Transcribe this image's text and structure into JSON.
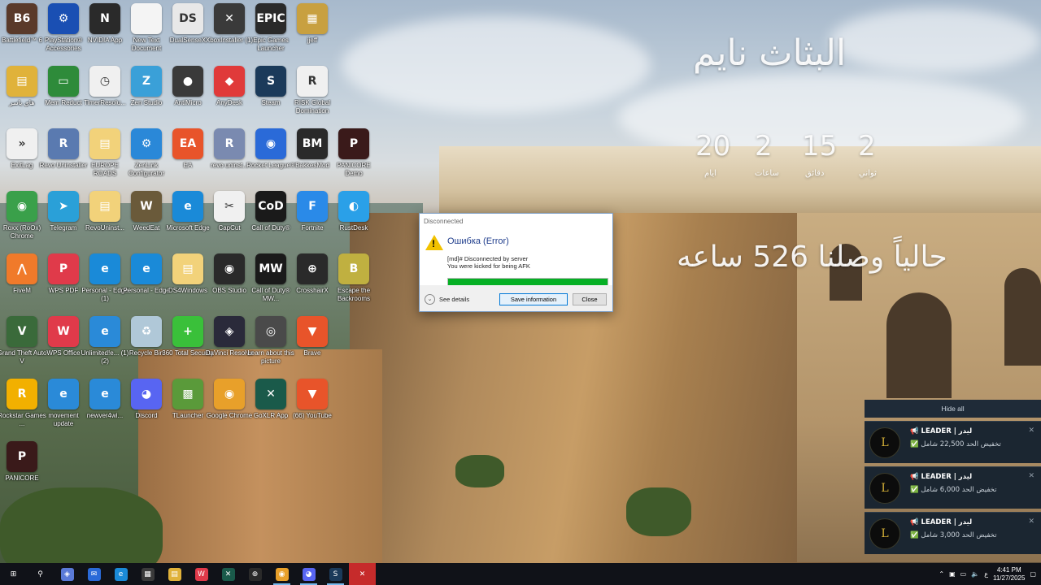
{
  "desktop_icons": [
    {
      "label": "Battlefield™ 6",
      "glyph": "B6",
      "color": "#5a3a2a",
      "col": 0,
      "row": 0
    },
    {
      "label": "PlayStation® Accessories",
      "glyph": "⚙",
      "color": "#1a4fb3",
      "col": 1,
      "row": 0
    },
    {
      "label": "NVIDIA App",
      "glyph": "N",
      "color": "#2a2a2a",
      "col": 2,
      "row": 0
    },
    {
      "label": "New Text Document",
      "glyph": "",
      "color": "#f4f4f4",
      "col": 3,
      "row": 0
    },
    {
      "label": "DualSenseX",
      "glyph": "DS",
      "color": "#e8e8e8",
      "col": 4,
      "row": 0
    },
    {
      "label": "XboxInstaller (1)",
      "glyph": "✕",
      "color": "#3a3a3a",
      "col": 5,
      "row": 0
    },
    {
      "label": "Epic Games Launcher",
      "glyph": "EPIC",
      "color": "#2a2a2a",
      "col": 6,
      "row": 0
    },
    {
      "label": "jjeff",
      "glyph": "▦",
      "color": "#c8a040",
      "col": 7,
      "row": 0
    },
    {
      "label": "هاي ياسر",
      "glyph": "▤",
      "color": "#e0b23a",
      "col": 0,
      "row": 1
    },
    {
      "label": "Mem Reduct",
      "glyph": "▭",
      "color": "#2e8b3a",
      "col": 1,
      "row": 1
    },
    {
      "label": "TimerResolu...",
      "glyph": "◷",
      "color": "#f0f0f0",
      "col": 2,
      "row": 1
    },
    {
      "label": "Zen Studio",
      "glyph": "Z",
      "color": "#3aa0d8",
      "col": 3,
      "row": 1
    },
    {
      "label": "AntiMicro",
      "glyph": "●",
      "color": "#3a3a3a",
      "col": 4,
      "row": 1
    },
    {
      "label": "AnyDesk",
      "glyph": "◆",
      "color": "#e03a3a",
      "col": 5,
      "row": 1
    },
    {
      "label": "Steam",
      "glyph": "S",
      "color": "#1b3a5a",
      "col": 6,
      "row": 1
    },
    {
      "label": "RISK Global Domination",
      "glyph": "R",
      "color": "#f0f0f0",
      "col": 7,
      "row": 1
    },
    {
      "label": "ExitLag",
      "glyph": "»",
      "color": "#f0f0f0",
      "col": 0,
      "row": 2
    },
    {
      "label": "Revo Uninstaller",
      "glyph": "R",
      "color": "#5a7ab0",
      "col": 1,
      "row": 2
    },
    {
      "label": "EUROPE ROADS",
      "glyph": "▤",
      "color": "#f2d27a",
      "col": 2,
      "row": 2
    },
    {
      "label": "ZenLink Configurator",
      "glyph": "⚙",
      "color": "#2a88d8",
      "col": 3,
      "row": 2
    },
    {
      "label": "EA",
      "glyph": "EA",
      "color": "#e8542a",
      "col": 4,
      "row": 2
    },
    {
      "label": "revo uninst...",
      "glyph": "R",
      "color": "#7a8ab0",
      "col": 5,
      "row": 2
    },
    {
      "label": "Rocket League®",
      "glyph": "◉",
      "color": "#2a6ad8",
      "col": 6,
      "row": 2
    },
    {
      "label": "BakkesMod",
      "glyph": "BM",
      "color": "#2a2a2a",
      "col": 7,
      "row": 2
    },
    {
      "label": "PANICORE Demo",
      "glyph": "P",
      "color": "#3a1a1a",
      "col": 8,
      "row": 2
    },
    {
      "label": "Roxx (RoOx) Chrome",
      "glyph": "◉",
      "color": "#3aa04a",
      "col": 0,
      "row": 3
    },
    {
      "label": "Telegram",
      "glyph": "➤",
      "color": "#2aa0d8",
      "col": 1,
      "row": 3
    },
    {
      "label": "RevoUninst...",
      "glyph": "▤",
      "color": "#f2d27a",
      "col": 2,
      "row": 3
    },
    {
      "label": "WeedEat",
      "glyph": "W",
      "color": "#6a5a3a",
      "col": 3,
      "row": 3
    },
    {
      "label": "Microsoft Edge",
      "glyph": "e",
      "color": "#1a8ad8",
      "col": 4,
      "row": 3
    },
    {
      "label": "CapCut",
      "glyph": "✂",
      "color": "#f0f0f0",
      "col": 5,
      "row": 3
    },
    {
      "label": "Call of Duty®",
      "glyph": "CoD",
      "color": "#1a1a1a",
      "col": 6,
      "row": 3
    },
    {
      "label": "Fortnite",
      "glyph": "F",
      "color": "#2a8ae8",
      "col": 7,
      "row": 3
    },
    {
      "label": "RustDesk",
      "glyph": "◐",
      "color": "#2aa0e8",
      "col": 8,
      "row": 3
    },
    {
      "label": "FiveM",
      "glyph": "⋀",
      "color": "#f07a2a",
      "col": 0,
      "row": 4
    },
    {
      "label": "WPS PDF",
      "glyph": "P",
      "color": "#e03a4a",
      "col": 1,
      "row": 4
    },
    {
      "label": "Personal - Edge (1)",
      "glyph": "e",
      "color": "#1a8ad8",
      "col": 2,
      "row": 4
    },
    {
      "label": "Personal - Edge",
      "glyph": "e",
      "color": "#1a8ad8",
      "col": 3,
      "row": 4
    },
    {
      "label": "DS4Windows",
      "glyph": "▤",
      "color": "#f2d27a",
      "col": 4,
      "row": 4
    },
    {
      "label": "OBS Studio",
      "glyph": "◉",
      "color": "#2a2a2a",
      "col": 5,
      "row": 4
    },
    {
      "label": "Call of Duty® MW...",
      "glyph": "MW",
      "color": "#1a1a1a",
      "col": 6,
      "row": 4
    },
    {
      "label": "CrosshairX",
      "glyph": "⊕",
      "color": "#2a2a2a",
      "col": 7,
      "row": 4
    },
    {
      "label": "Escape the Backrooms",
      "glyph": "B",
      "color": "#c0b040",
      "col": 8,
      "row": 4
    },
    {
      "label": "Grand Theft Auto V",
      "glyph": "V",
      "color": "#3a6a3a",
      "col": 0,
      "row": 5
    },
    {
      "label": "WPS Office",
      "glyph": "W",
      "color": "#e03a4a",
      "col": 1,
      "row": 5
    },
    {
      "label": "Unlimited!e... (1) (2)",
      "glyph": "e",
      "color": "#2a8ad8",
      "col": 2,
      "row": 5
    },
    {
      "label": "Recycle Bin",
      "glyph": "♻",
      "color": "#b0c8d8",
      "col": 3,
      "row": 5
    },
    {
      "label": "360 Total Security",
      "glyph": "+",
      "color": "#3ac03a",
      "col": 4,
      "row": 5
    },
    {
      "label": "DaVinci Resolve",
      "glyph": "◈",
      "color": "#2a2a3a",
      "col": 5,
      "row": 5
    },
    {
      "label": "Learn about this picture",
      "glyph": "◎",
      "color": "#4a4a4a",
      "col": 6,
      "row": 5
    },
    {
      "label": "Brave",
      "glyph": "▼",
      "color": "#e8542a",
      "col": 7,
      "row": 5
    },
    {
      "label": "Rockstar Games ...",
      "glyph": "R",
      "color": "#f2b000",
      "col": 0,
      "row": 6
    },
    {
      "label": "movement update",
      "glyph": "e",
      "color": "#2a8ad8",
      "col": 1,
      "row": 6
    },
    {
      "label": "newver4wi...",
      "glyph": "e",
      "color": "#2a8ad8",
      "col": 2,
      "row": 6
    },
    {
      "label": "Discord",
      "glyph": "◕",
      "color": "#5865f2",
      "col": 3,
      "row": 6
    },
    {
      "label": "TLauncher",
      "glyph": "▩",
      "color": "#5a9a3a",
      "col": 4,
      "row": 6
    },
    {
      "label": "Google Chrome",
      "glyph": "◉",
      "color": "#e8a02a",
      "col": 5,
      "row": 6
    },
    {
      "label": "GoXLR App",
      "glyph": "✕",
      "color": "#1a5a4a",
      "col": 6,
      "row": 6
    },
    {
      "label": "(66) YouTube",
      "glyph": "▼",
      "color": "#e8542a",
      "col": 7,
      "row": 6
    },
    {
      "label": "PANICORE",
      "glyph": "P",
      "color": "#3a1a1a",
      "col": 0,
      "row": 7
    }
  ],
  "widget": {
    "title": "البثاث نايم",
    "counts": [
      "20",
      "2",
      "15",
      "2"
    ],
    "units": [
      "ايام",
      "ساعات",
      "دقائق",
      "ثواني"
    ],
    "line": "حالياً وصلنا 526 ساعه"
  },
  "dialog": {
    "window_title": "Disconnected",
    "heading": "Ошибка (Error)",
    "message_line1": "[md]# Disconnected by server",
    "message_line2": "You were kicked for being AFK",
    "progress": 1.0,
    "see_details": "See details",
    "save_button": "Save information",
    "close_button": "Close"
  },
  "notifications": {
    "hide_all": "Hide all",
    "items": [
      {
        "title": "📢 LEADER | ليدر",
        "body": "✅ تخفيض الحد 22,500 شامل"
      },
      {
        "title": "📢 LEADER | ليدر",
        "body": "✅ تخفيض الحد 6,000 شامل"
      },
      {
        "title": "📢 LEADER | ليدر",
        "body": "✅ تخفيض الحد 3,000 شامل"
      }
    ]
  },
  "taskbar": {
    "apps": [
      {
        "name": "start-button",
        "glyph": "⊞",
        "color": "#101218"
      },
      {
        "name": "search-icon",
        "glyph": "⚲",
        "color": "#101218"
      },
      {
        "name": "copilot-icon",
        "glyph": "◈",
        "color": "#5a7ad8"
      },
      {
        "name": "mail-icon",
        "glyph": "✉",
        "color": "#2a6ad8"
      },
      {
        "name": "edge-icon",
        "glyph": "e",
        "color": "#1a8ad8"
      },
      {
        "name": "store-icon",
        "glyph": "▦",
        "color": "#3a3a3a"
      },
      {
        "name": "file-explorer-icon",
        "glyph": "▤",
        "color": "#e0b23a"
      },
      {
        "name": "wps-icon",
        "glyph": "W",
        "color": "#e03a4a"
      },
      {
        "name": "goxlr-icon",
        "glyph": "✕",
        "color": "#1a5a4a"
      },
      {
        "name": "crosshair-icon",
        "glyph": "⊕",
        "color": "#2a2a2a"
      },
      {
        "name": "chrome-icon",
        "glyph": "◉",
        "color": "#e8a02a"
      },
      {
        "name": "discord-icon",
        "glyph": "◕",
        "color": "#5865f2"
      },
      {
        "name": "steam-icon",
        "glyph": "S",
        "color": "#1b3a5a"
      },
      {
        "name": "error-app-icon",
        "glyph": "✕",
        "color": "#c62b2b"
      }
    ],
    "language": "ع",
    "time": "4:41 PM",
    "date": "11/27/2025"
  }
}
